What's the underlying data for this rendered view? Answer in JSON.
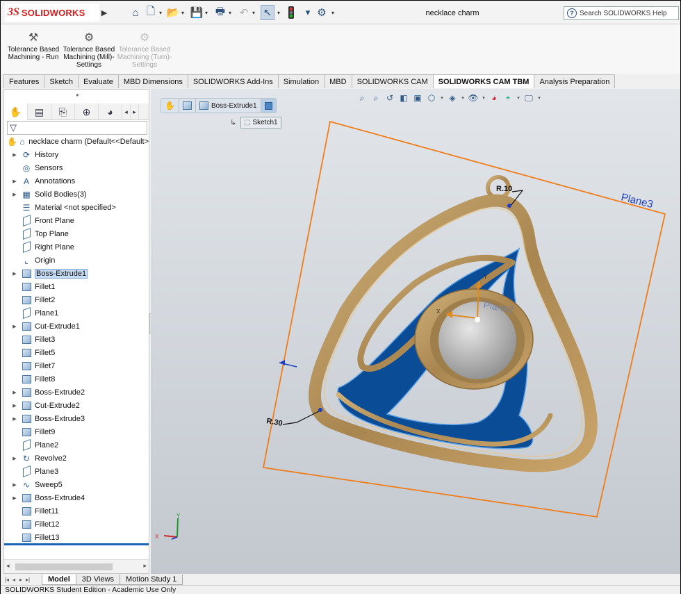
{
  "app": {
    "brand_prefix": "3S",
    "brand_name": "SOLIDWORKS",
    "window_title": "necklace charm",
    "help_placeholder": "Search SOLIDWORKS Help"
  },
  "quick_access": [
    "home-icon",
    "new-document-icon",
    "open-icon",
    "save-icon",
    "print-icon",
    "undo-icon",
    "select-pointer-icon",
    "rebuild-traffic-light-icon",
    "options-gear-icon"
  ],
  "ribbon": {
    "buttons": [
      {
        "label": "Tolerance Based Machining - Run",
        "icon": "tbm-run-icon",
        "enabled": true
      },
      {
        "label": "Tolerance Based Machining (Mill)- Settings",
        "icon": "gear-icon",
        "enabled": true
      },
      {
        "label": "Tolerance Based Machining (Turn)- Settings",
        "icon": "gear-icon",
        "enabled": false
      }
    ]
  },
  "tabs": [
    "Features",
    "Sketch",
    "Evaluate",
    "MBD Dimensions",
    "SOLIDWORKS Add-Ins",
    "Simulation",
    "MBD",
    "SOLIDWORKS CAM",
    "SOLIDWORKS CAM TBM",
    "Analysis Preparation"
  ],
  "active_tab": "SOLIDWORKS CAM TBM",
  "feature_tree": {
    "root": "necklace charm  (Default<<Default>",
    "nodes": [
      {
        "label": "History",
        "icon": "history",
        "expandable": true
      },
      {
        "label": "Sensors",
        "icon": "sensors",
        "expandable": false
      },
      {
        "label": "Annotations",
        "icon": "annotations",
        "expandable": true
      },
      {
        "label": "Solid Bodies(3)",
        "icon": "solid-bodies",
        "expandable": true
      },
      {
        "label": "Material <not specified>",
        "icon": "material",
        "expandable": false
      },
      {
        "label": "Front Plane",
        "icon": "plane",
        "expandable": false
      },
      {
        "label": "Top Plane",
        "icon": "plane",
        "expandable": false
      },
      {
        "label": "Right Plane",
        "icon": "plane",
        "expandable": false
      },
      {
        "label": "Origin",
        "icon": "origin",
        "expandable": false
      },
      {
        "label": "Boss-Extrude1",
        "icon": "extrude",
        "expandable": true,
        "selected": true
      },
      {
        "label": "Fillet1",
        "icon": "fillet",
        "expandable": false
      },
      {
        "label": "Fillet2",
        "icon": "fillet",
        "expandable": false
      },
      {
        "label": "Plane1",
        "icon": "plane",
        "expandable": false
      },
      {
        "label": "Cut-Extrude1",
        "icon": "extrude",
        "expandable": true
      },
      {
        "label": "Fillet3",
        "icon": "fillet",
        "expandable": false
      },
      {
        "label": "Fillet5",
        "icon": "fillet",
        "expandable": false
      },
      {
        "label": "Fillet7",
        "icon": "fillet",
        "expandable": false
      },
      {
        "label": "Fillet8",
        "icon": "fillet",
        "expandable": false
      },
      {
        "label": "Boss-Extrude2",
        "icon": "extrude",
        "expandable": true
      },
      {
        "label": "Cut-Extrude2",
        "icon": "extrude",
        "expandable": true
      },
      {
        "label": "Boss-Extrude3",
        "icon": "extrude",
        "expandable": true
      },
      {
        "label": "Fillet9",
        "icon": "fillet",
        "expandable": false
      },
      {
        "label": "Plane2",
        "icon": "plane",
        "expandable": false
      },
      {
        "label": "Revolve2",
        "icon": "revolve",
        "expandable": true
      },
      {
        "label": "Plane3",
        "icon": "plane",
        "expandable": false
      },
      {
        "label": "Sweep5",
        "icon": "sweep",
        "expandable": true
      },
      {
        "label": "Boss-Extrude4",
        "icon": "extrude",
        "expandable": true
      },
      {
        "label": "Fillet11",
        "icon": "fillet",
        "expandable": false
      },
      {
        "label": "Fillet12",
        "icon": "fillet",
        "expandable": false
      },
      {
        "label": "Fillet13",
        "icon": "fillet",
        "expandable": false
      }
    ]
  },
  "breadcrumb": {
    "items": [
      "Boss-Extrude1"
    ],
    "sub_item": "Sketch1"
  },
  "viewport": {
    "plane_label": "Plane3",
    "inner_plane_label": "Plane2",
    "dim_small": "R.10",
    "dim_large": "R.30",
    "triad_y": "Y",
    "triad_x": "X",
    "axis_y": "Y",
    "axis_x": "X",
    "colors": {
      "plane_orange": "#f07d1a",
      "charm_gold": "#b4935c",
      "selected_blue": "#0a4c96",
      "sphere_grey": "#b8b8b8"
    }
  },
  "bottom_tabs": [
    "Model",
    "3D Views",
    "Motion Study 1"
  ],
  "active_bottom_tab": "Model",
  "status_bar": "SOLIDWORKS Student Edition - Academic Use Only"
}
